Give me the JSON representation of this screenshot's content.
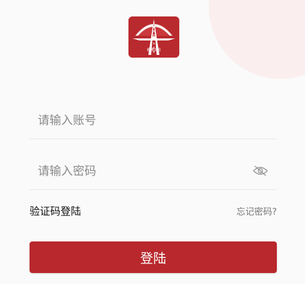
{
  "colors": {
    "brand": "#b8282c",
    "background": "#fafafa",
    "placeholder": "#8a8a8a",
    "link": "#777777"
  },
  "logo": {
    "icon": "airport-runway-logo",
    "caption": "航港云监"
  },
  "form": {
    "account_placeholder": "请输入账号",
    "account_value": "",
    "password_placeholder": "请输入密码",
    "password_value": "",
    "password_toggle_icon": "eye-hidden-icon"
  },
  "links": {
    "sms_login": "验证码登陆",
    "forgot_password": "忘记密码?"
  },
  "actions": {
    "login_label": "登陆"
  }
}
